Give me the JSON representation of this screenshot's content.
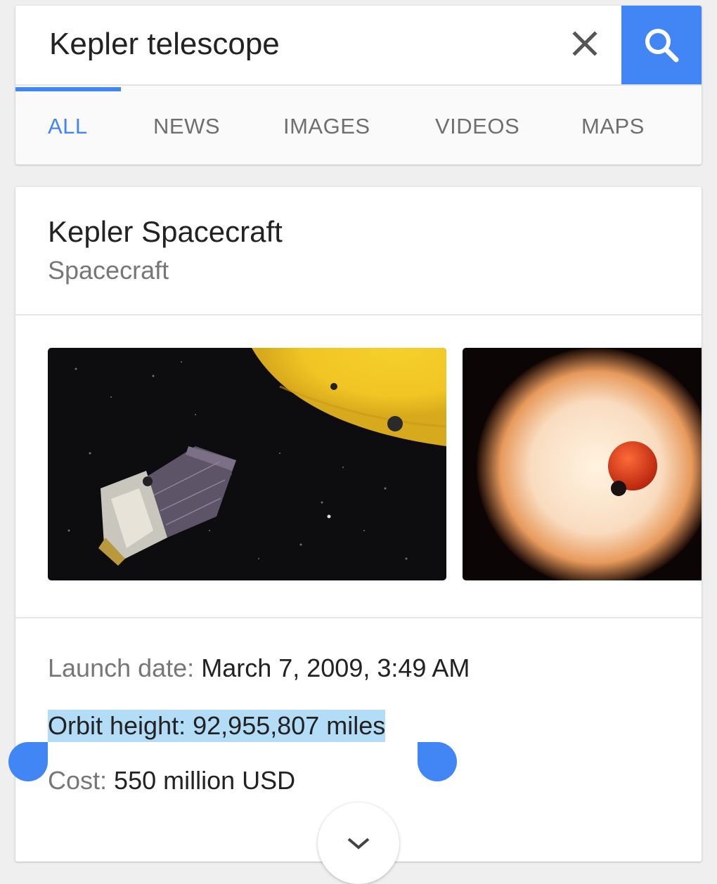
{
  "search": {
    "query": "Kepler telescope",
    "clear_icon": "close-icon",
    "search_icon": "search-icon",
    "accent_color": "#4285f4"
  },
  "tabs": [
    {
      "label": "ALL",
      "active": true
    },
    {
      "label": "NEWS",
      "active": false
    },
    {
      "label": "IMAGES",
      "active": false
    },
    {
      "label": "VIDEOS",
      "active": false
    },
    {
      "label": "MAPS",
      "active": false
    }
  ],
  "knowledge_panel": {
    "title": "Kepler Spacecraft",
    "subtitle": "Spacecraft",
    "images": [
      {
        "icon": "spacecraft-image"
      },
      {
        "icon": "red-planet-star-image"
      }
    ],
    "facts": {
      "launch_label": "Launch date:",
      "launch_value": "March 7, 2009, 3:49 AM",
      "orbit_label": "Orbit height:",
      "orbit_value": "92,955,807 miles",
      "cost_label": "Cost:",
      "cost_value": "550 million USD"
    },
    "selection_color": "#b3dcf7",
    "expand_icon": "chevron-down-icon"
  }
}
